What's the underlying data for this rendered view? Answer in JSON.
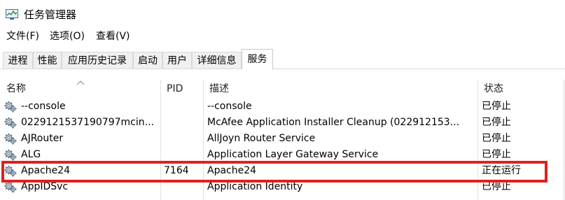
{
  "window": {
    "title": "任务管理器",
    "icon": "task-manager-icon"
  },
  "menu": [
    "文件(F)",
    "选项(O)",
    "查看(V)"
  ],
  "tabs": [
    "进程",
    "性能",
    "应用历史记录",
    "启动",
    "用户",
    "详细信息",
    "服务"
  ],
  "active_tab": "服务",
  "columns": [
    "名称",
    "PID",
    "描述",
    "状态"
  ],
  "sort": {
    "column": "名称",
    "direction": "ascending"
  },
  "rows": [
    {
      "name": "--console",
      "pid": "",
      "desc": "--console",
      "status": "已停止"
    },
    {
      "name": "0229121537190797mcin...",
      "pid": "",
      "desc": "McAfee Application Installer Cleanup (022912153...",
      "status": "已停止"
    },
    {
      "name": "AJRouter",
      "pid": "",
      "desc": "AllJoyn Router Service",
      "status": "已停止"
    },
    {
      "name": "ALG",
      "pid": "",
      "desc": "Application Layer Gateway Service",
      "status": "已停止"
    },
    {
      "name": "Apache24",
      "pid": "7164",
      "desc": "Apache24",
      "status": "正在运行",
      "highlighted": true
    },
    {
      "name": "AppIDSvc",
      "pid": "",
      "desc": "Application Identity",
      "status": "已停止"
    }
  ],
  "colors": {
    "highlight_border": "#e02020",
    "grid_line": "#e2e2e2",
    "tab_border": "#d9d9d9"
  }
}
